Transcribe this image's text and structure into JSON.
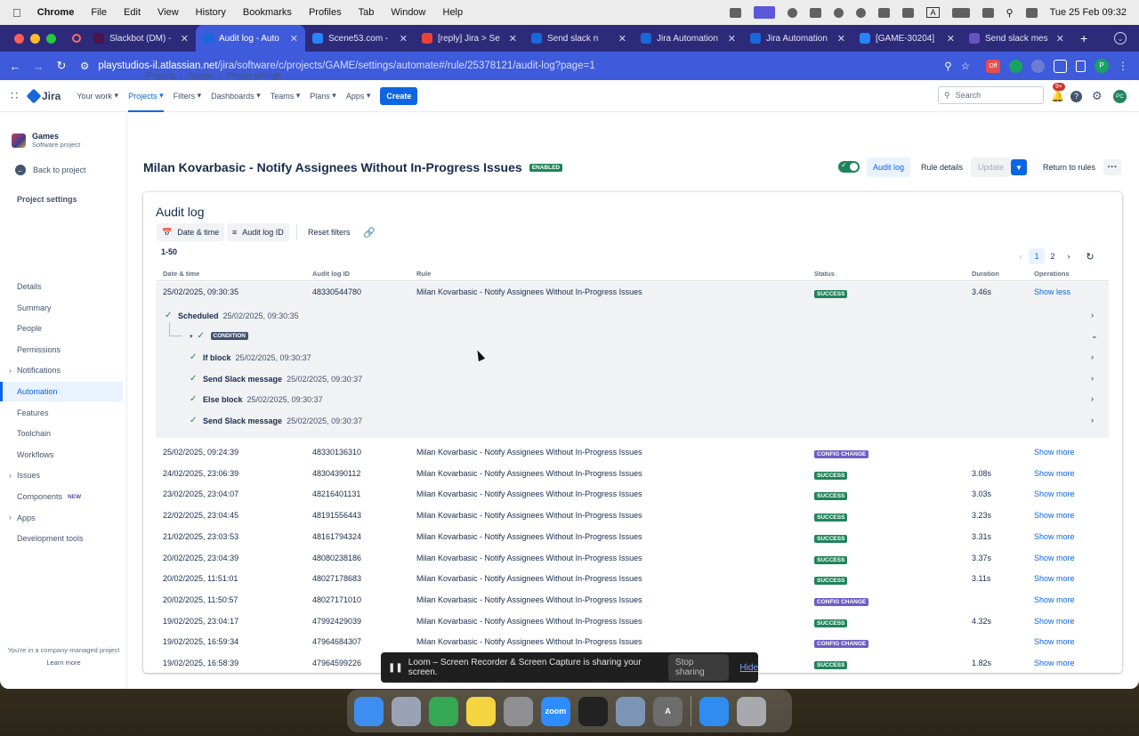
{
  "menubar": {
    "app": "Chrome",
    "items": [
      "File",
      "Edit",
      "View",
      "History",
      "Bookmarks",
      "Profiles",
      "Tab",
      "Window",
      "Help"
    ],
    "datetime": "Tue 25 Feb  09:32",
    "ime": "A"
  },
  "tabs": [
    {
      "title": "Slackbot (DM) -",
      "color": "#4a154b"
    },
    {
      "title": "Audit log - Auto",
      "color": "#1868db",
      "active": true
    },
    {
      "title": "Scene53.com -",
      "color": "#2684ff"
    },
    {
      "title": "[reply] Jira > Se",
      "color": "#ea4335"
    },
    {
      "title": "Send slack n",
      "color": "#1868db"
    },
    {
      "title": "Jira Automation",
      "color": "#1868db"
    },
    {
      "title": "Jira Automation",
      "color": "#1868db"
    },
    {
      "title": "[GAME-30204]",
      "color": "#2684ff"
    },
    {
      "title": "Send slack mes",
      "color": "#6554c0"
    }
  ],
  "url": {
    "host": "playstudios-il.atlassian.net",
    "path": "/jira/software/c/projects/GAME/settings/automate#/rule/25378121/audit-log?page=1"
  },
  "profile": "P",
  "ext_badge": "Off",
  "topnav": {
    "items": [
      "Your work",
      "Projects",
      "Filters",
      "Dashboards",
      "Teams",
      "Plans",
      "Apps"
    ],
    "selected": "Projects",
    "create": "Create",
    "search_placeholder": "Search",
    "notif_count": "9+",
    "avatar": "PC",
    "logo": "Jira"
  },
  "sidebar": {
    "project_name": "Games",
    "project_type": "Software project",
    "back": "Back to project",
    "heading": "Project settings",
    "items": [
      "Details",
      "Summary",
      "People",
      "Permissions",
      "Notifications",
      "Automation",
      "Features",
      "Toolchain",
      "Workflows",
      "Issues",
      "Components",
      "Apps",
      "Development tools"
    ],
    "expandable": [
      "Notifications",
      "Issues",
      "Apps"
    ],
    "selected": "Automation",
    "new_badge": "NEW",
    "footer": "You're in a company-managed project",
    "learn_more": "Learn more"
  },
  "breadcrumb": [
    "Projects",
    "Games",
    "Project settings"
  ],
  "rule": {
    "title": "Milan Kovarbasic - Notify Assignees Without In-Progress Issues",
    "state": "ENABLED"
  },
  "actions": {
    "audit_log": "Audit log",
    "rule_details": "Rule details",
    "update": "Update",
    "return": "Return to rules"
  },
  "audit": {
    "heading": "Audit log",
    "filter_date": "Date & time",
    "filter_id": "Audit log ID",
    "reset": "Reset filters",
    "range": "1-50",
    "pages": [
      "1",
      "2"
    ],
    "current_page": "1",
    "columns": [
      "Date & time",
      "Audit log ID",
      "Rule",
      "Status",
      "Duration",
      "Operations"
    ]
  },
  "expanded": {
    "date": "25/02/2025, 09:30:35",
    "id": "48330544780",
    "rule": "Milan Kovarbasic - Notify Assignees Without In-Progress Issues",
    "status": "SUCCESS",
    "duration": "3.46s",
    "op": "Show less",
    "steps": [
      {
        "label": "Scheduled",
        "time": "25/02/2025, 09:30:35"
      },
      {
        "label": "CONDITION",
        "time": ""
      },
      {
        "label": "If block",
        "time": "25/02/2025, 09:30:37"
      },
      {
        "label": "Send Slack message",
        "time": "25/02/2025, 09:30:37"
      },
      {
        "label": "Else block",
        "time": "25/02/2025, 09:30:37"
      },
      {
        "label": "Send Slack message",
        "time": "25/02/2025, 09:30:37"
      }
    ]
  },
  "rows": [
    {
      "date": "25/02/2025, 09:24:39",
      "id": "48330136310",
      "rule": "Milan Kovarbasic - Notify Assignees Without In-Progress Issues",
      "status": "CONFIG CHANGE",
      "duration": "",
      "op": "Show more"
    },
    {
      "date": "24/02/2025, 23:06:39",
      "id": "48304390112",
      "rule": "Milan Kovarbasic - Notify Assignees Without In-Progress Issues",
      "status": "SUCCESS",
      "duration": "3.08s",
      "op": "Show more"
    },
    {
      "date": "23/02/2025, 23:04:07",
      "id": "48216401131",
      "rule": "Milan Kovarbasic - Notify Assignees Without In-Progress Issues",
      "status": "SUCCESS",
      "duration": "3.03s",
      "op": "Show more"
    },
    {
      "date": "22/02/2025, 23:04:45",
      "id": "48191556443",
      "rule": "Milan Kovarbasic - Notify Assignees Without In-Progress Issues",
      "status": "SUCCESS",
      "duration": "3.23s",
      "op": "Show more"
    },
    {
      "date": "21/02/2025, 23:03:53",
      "id": "48161794324",
      "rule": "Milan Kovarbasic - Notify Assignees Without In-Progress Issues",
      "status": "SUCCESS",
      "duration": "3.31s",
      "op": "Show more"
    },
    {
      "date": "20/02/2025, 23:04:39",
      "id": "48080238186",
      "rule": "Milan Kovarbasic - Notify Assignees Without In-Progress Issues",
      "status": "SUCCESS",
      "duration": "3.37s",
      "op": "Show more"
    },
    {
      "date": "20/02/2025, 11:51:01",
      "id": "48027178683",
      "rule": "Milan Kovarbasic - Notify Assignees Without In-Progress Issues",
      "status": "SUCCESS",
      "duration": "3.11s",
      "op": "Show more"
    },
    {
      "date": "20/02/2025, 11:50:57",
      "id": "48027171010",
      "rule": "Milan Kovarbasic - Notify Assignees Without In-Progress Issues",
      "status": "CONFIG CHANGE",
      "duration": "",
      "op": "Show more"
    },
    {
      "date": "19/02/2025, 23:04:17",
      "id": "47992429039",
      "rule": "Milan Kovarbasic - Notify Assignees Without In-Progress Issues",
      "status": "SUCCESS",
      "duration": "4.32s",
      "op": "Show more"
    },
    {
      "date": "19/02/2025, 16:59:34",
      "id": "47964684307",
      "rule": "Milan Kovarbasic - Notify Assignees Without In-Progress Issues",
      "status": "CONFIG CHANGE",
      "duration": "",
      "op": "Show more"
    },
    {
      "date": "19/02/2025, 16:58:39",
      "id": "47964599226",
      "rule": "",
      "status": "SUCCESS",
      "duration": "1.82s",
      "op": "Show more"
    }
  ],
  "loom": {
    "text": "Loom – Screen Recorder & Screen Capture is sharing your screen.",
    "stop": "Stop sharing",
    "hide": "Hide"
  },
  "dock": [
    {
      "name": "finder",
      "color": "#3d8ef0"
    },
    {
      "name": "launchpad",
      "color": "#9aa3b5"
    },
    {
      "name": "chrome",
      "color": "#34a853"
    },
    {
      "name": "notes",
      "color": "#f5d442"
    },
    {
      "name": "system-settings",
      "color": "#8e8e93"
    },
    {
      "name": "zoom",
      "color": "#2d8cff",
      "label": "zoom"
    },
    {
      "name": "pritunl",
      "color": "#222"
    },
    {
      "name": "preview",
      "color": "#7d95b5"
    },
    {
      "name": "dictionary",
      "color": "#6d6d6d",
      "label": "A"
    },
    {
      "name": "mail",
      "color": "#2f8cf0"
    },
    {
      "name": "trash",
      "color": "#a7a9ad"
    }
  ]
}
